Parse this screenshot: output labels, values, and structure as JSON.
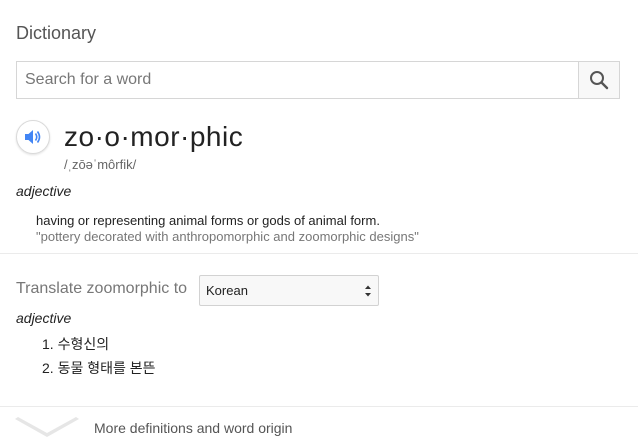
{
  "dictionary": {
    "title": "Dictionary",
    "search_placeholder": "Search for a word"
  },
  "entry": {
    "headword": "zo·o·mor·phic",
    "phonetic": "/ˌzōəˈmôrfik/",
    "part_of_speech": "adjective",
    "definition": "having or representing animal forms or gods of animal form.",
    "example": "\"pottery decorated with anthropomorphic and zoomorphic designs\""
  },
  "translate": {
    "label": "Translate zoomorphic to",
    "selected_language": "Korean",
    "part_of_speech": "adjective",
    "items": [
      "1. 수형신의",
      "2. 동물 형태를 본뜬"
    ]
  },
  "footer": {
    "more_label": "More definitions and word origin"
  },
  "icons": {
    "search": "search-icon",
    "speaker": "speaker-icon",
    "select_arrows": "select-arrows-icon",
    "expand": "chevron-down-icon"
  },
  "colors": {
    "speaker_blue": "#4285f4",
    "example_gray": "#777777",
    "divider": "#ebebeb"
  }
}
